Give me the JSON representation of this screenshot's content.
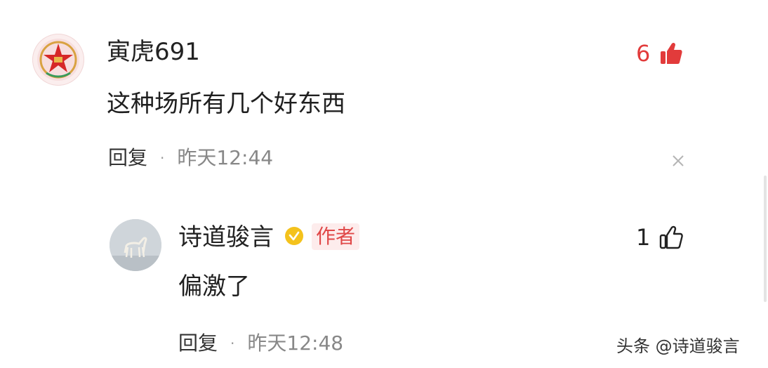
{
  "comment": {
    "username": "寅虎691",
    "text": "这种场所有几个好东西",
    "reply_label": "回复",
    "separator": "·",
    "time": "昨天12:44",
    "likes": "6",
    "like_color": "#e23b3b",
    "avatar_icon": "army-emblem",
    "dismiss_icon": "close-icon"
  },
  "reply": {
    "username": "诗道骏言",
    "verified_icon": "verified-badge",
    "badge": "作者",
    "badge_color": "#e04848",
    "text": "偏激了",
    "reply_label": "回复",
    "separator": "·",
    "time": "昨天12:48",
    "likes": "1",
    "avatar_icon": "horse-photo"
  },
  "watermark": "头条 @诗道骏言"
}
